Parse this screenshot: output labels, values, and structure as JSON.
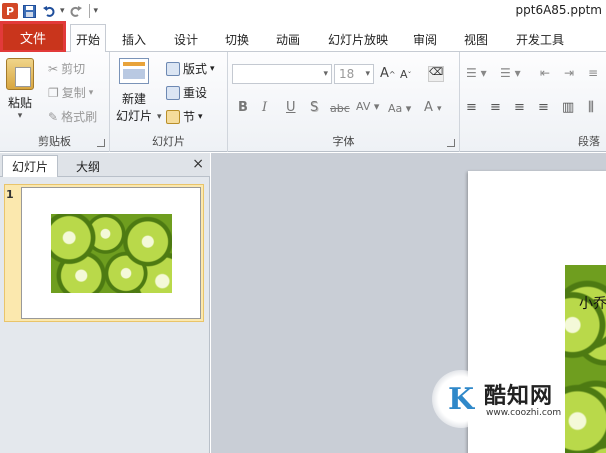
{
  "window": {
    "title": "ppt6A85.pptm"
  },
  "qat": {
    "undo_icon": "undo-icon",
    "redo_icon": "redo-icon",
    "save_icon": "save-icon",
    "app_badge": "P"
  },
  "tabs": [
    {
      "label": "文件"
    },
    {
      "label": "开始"
    },
    {
      "label": "插入"
    },
    {
      "label": "设计"
    },
    {
      "label": "切换"
    },
    {
      "label": "动画"
    },
    {
      "label": "幻灯片放映"
    },
    {
      "label": "审阅"
    },
    {
      "label": "视图"
    },
    {
      "label": "开发工具"
    }
  ],
  "ribbon": {
    "clipboard": {
      "label": "剪贴板",
      "paste": "粘贴",
      "cut": "剪切",
      "copy": "复制",
      "format_painter": "格式刷"
    },
    "slides": {
      "label": "幻灯片",
      "new_slide_line1": "新建",
      "new_slide_line2": "幻灯片",
      "layout": "版式",
      "reset": "重设",
      "section": "节"
    },
    "font": {
      "label": "字体",
      "size_value": "18",
      "bold": "B",
      "italic": "I",
      "underline": "U",
      "shadow": "S",
      "strike": "abc",
      "spacing": "AV",
      "case": "Aa",
      "color": "A",
      "grow": "A",
      "shrink": "A"
    },
    "paragraph": {
      "label": "段落"
    }
  },
  "panel": {
    "tab_slides": "幻灯片",
    "tab_outline": "大纲",
    "close": "×",
    "slide_number": "1"
  },
  "slide": {
    "text": "小乔"
  },
  "watermark": {
    "name": "酷知网",
    "url": "www.coozhi.com",
    "logo_letter": "K"
  },
  "colors": {
    "file_tab": "#c9351c",
    "highlight_box": "#e23a3a",
    "ribbon_bg": "#eef1f5"
  }
}
